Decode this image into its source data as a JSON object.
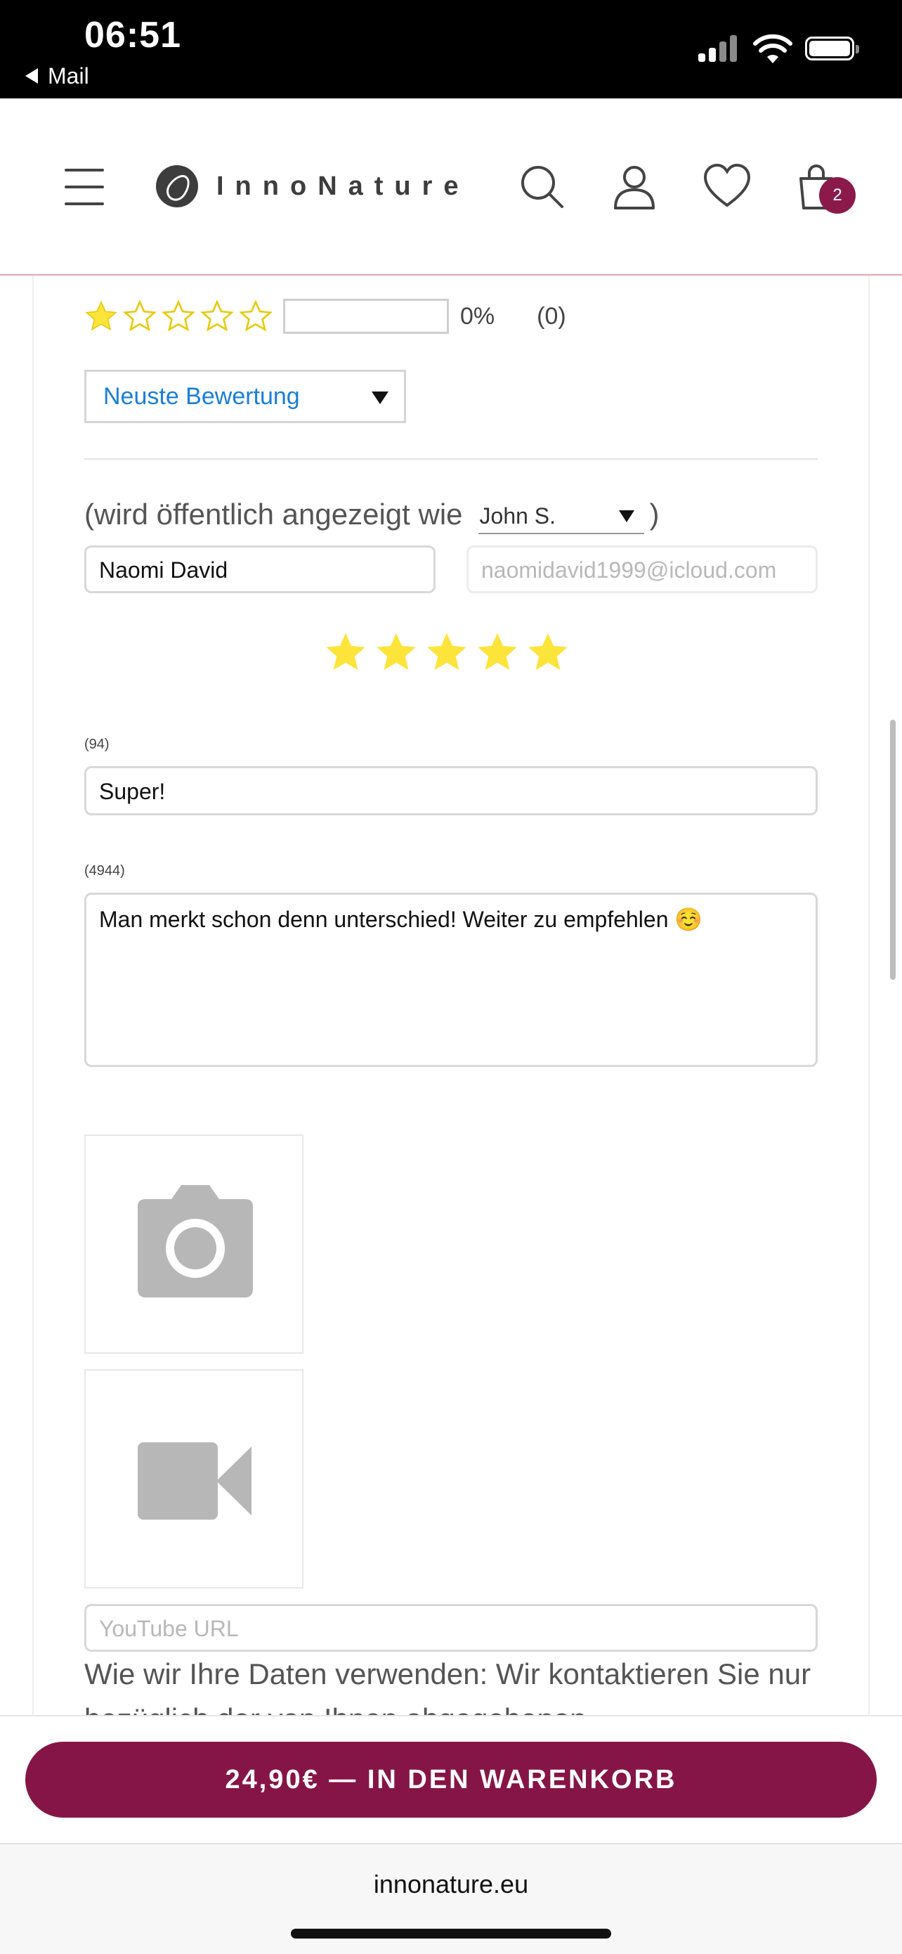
{
  "status_bar": {
    "time": "06:51",
    "back_app": "Mail"
  },
  "header": {
    "logo_text": "InnoNature",
    "cart_count": "2"
  },
  "rating_summary": {
    "stars": 1,
    "percent": "0%",
    "count": "(0)"
  },
  "sort": {
    "selected": "Neuste Bewertung"
  },
  "review_form": {
    "display_as_prefix": "(wird öffentlich angezeigt wie",
    "display_as_value": "John S.",
    "display_as_suffix": ")",
    "name_value": "Naomi David",
    "email_placeholder": "naomidavid1999@icloud.com",
    "rating": 5,
    "title_counter": "(94)",
    "title_value": "Super!",
    "body_counter": "(4944)",
    "body_value": "Man merkt schon denn unterschied! Weiter zu empfehlen ☺️",
    "youtube_placeholder": "YouTube URL",
    "privacy_text": "Wie wir Ihre Daten verwenden: Wir kontaktieren Sie nur bezüglich der von Ihnen abgegebenen"
  },
  "sticky": {
    "cart_button_label": "24,90€ — IN DEN WARENKORB"
  },
  "browser": {
    "url": "innonature.eu"
  },
  "colors": {
    "brand": "#861547",
    "star": "#FCE43B",
    "link": "#1a7fd6"
  },
  "icons": [
    "hamburger-icon",
    "logo-leaf-icon",
    "search-icon",
    "account-icon",
    "heart-icon",
    "cart-icon",
    "star-icon",
    "camera-icon",
    "video-camera-icon"
  ]
}
